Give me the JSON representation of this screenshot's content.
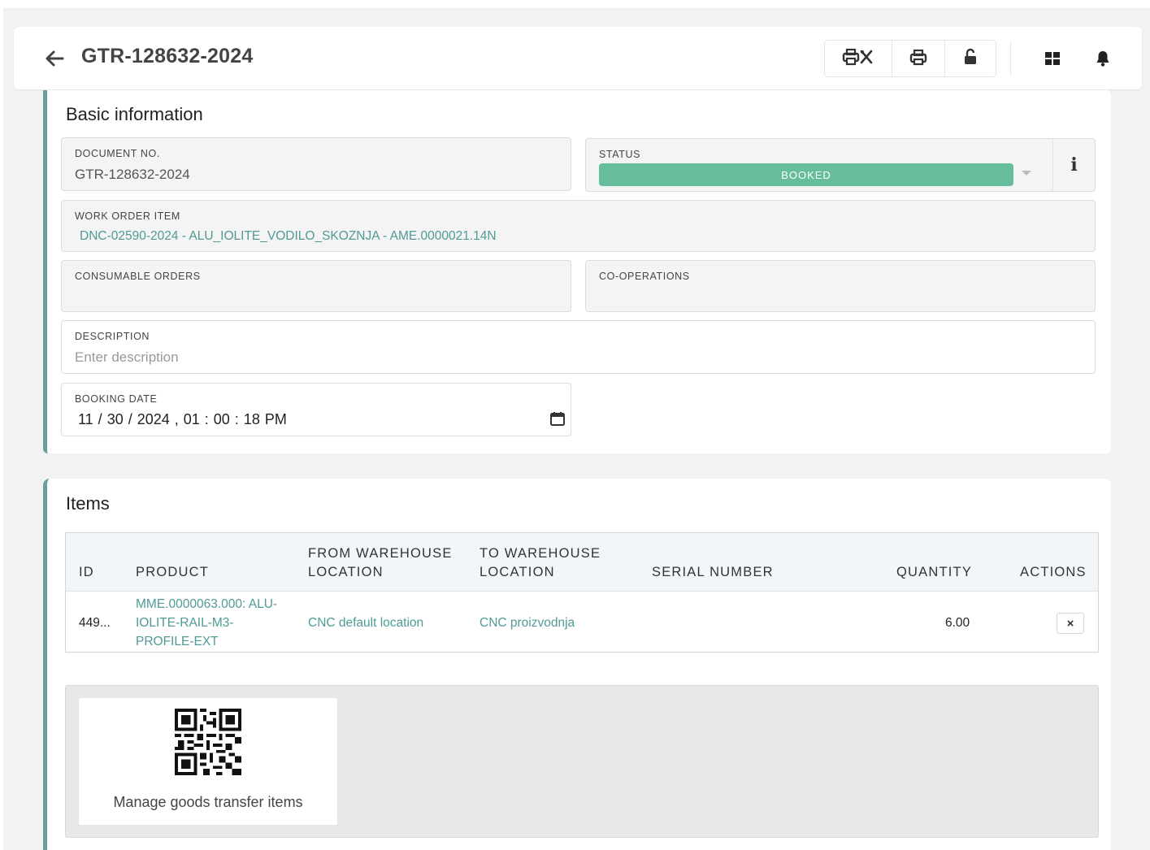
{
  "header": {
    "title": "GTR-128632-2024",
    "toolbar_icons": [
      "print-tools-icon",
      "print-icon",
      "unlock-icon",
      "grid-icon",
      "bell-icon"
    ]
  },
  "basic_info": {
    "title": "Basic information",
    "document_no": {
      "label": "DOCUMENT NO.",
      "value": "GTR-128632-2024"
    },
    "status": {
      "label": "STATUS",
      "value": "BOOKED",
      "color": "#66bd9c"
    },
    "work_order_item": {
      "label": "WORK ORDER ITEM",
      "value": "DNC-02590-2024 - ALU_IOLITE_VODILO_SKOZNJA - AME.0000021.14N"
    },
    "consumable_orders": {
      "label": "CONSUMABLE ORDERS",
      "value": ""
    },
    "co_operations": {
      "label": "CO-OPERATIONS",
      "value": ""
    },
    "description": {
      "label": "DESCRIPTION",
      "placeholder": "Enter description",
      "value": ""
    },
    "booking_date": {
      "label": "BOOKING DATE",
      "value": "11 / 30 / 2024 ,  01 : 00 : 18  PM"
    }
  },
  "items": {
    "title": "Items",
    "columns": {
      "id": "ID",
      "product": "PRODUCT",
      "from_wh_1": "FROM WAREHOUSE",
      "from_wh_2": "LOCATION",
      "to_wh_1": "TO WAREHOUSE",
      "to_wh_2": "LOCATION",
      "serial": "SERIAL NUMBER",
      "quantity": "QUANTITY",
      "actions": "ACTIONS"
    },
    "rows": [
      {
        "id": "449...",
        "product_line1": "MME.0000063.000: ALU-",
        "product_line2": "IOLITE-RAIL-M3-",
        "product_line3": "PROFILE-EXT",
        "from_location": "CNC default location",
        "to_location": "CNC proizvodnja",
        "serial_number": "",
        "quantity": "6.00",
        "action": "×"
      }
    ],
    "manage_label": "Manage goods transfer items"
  },
  "colors": {
    "accent": "#6a9e9b",
    "link": "#4f9a96",
    "status": "#66bd9c"
  }
}
